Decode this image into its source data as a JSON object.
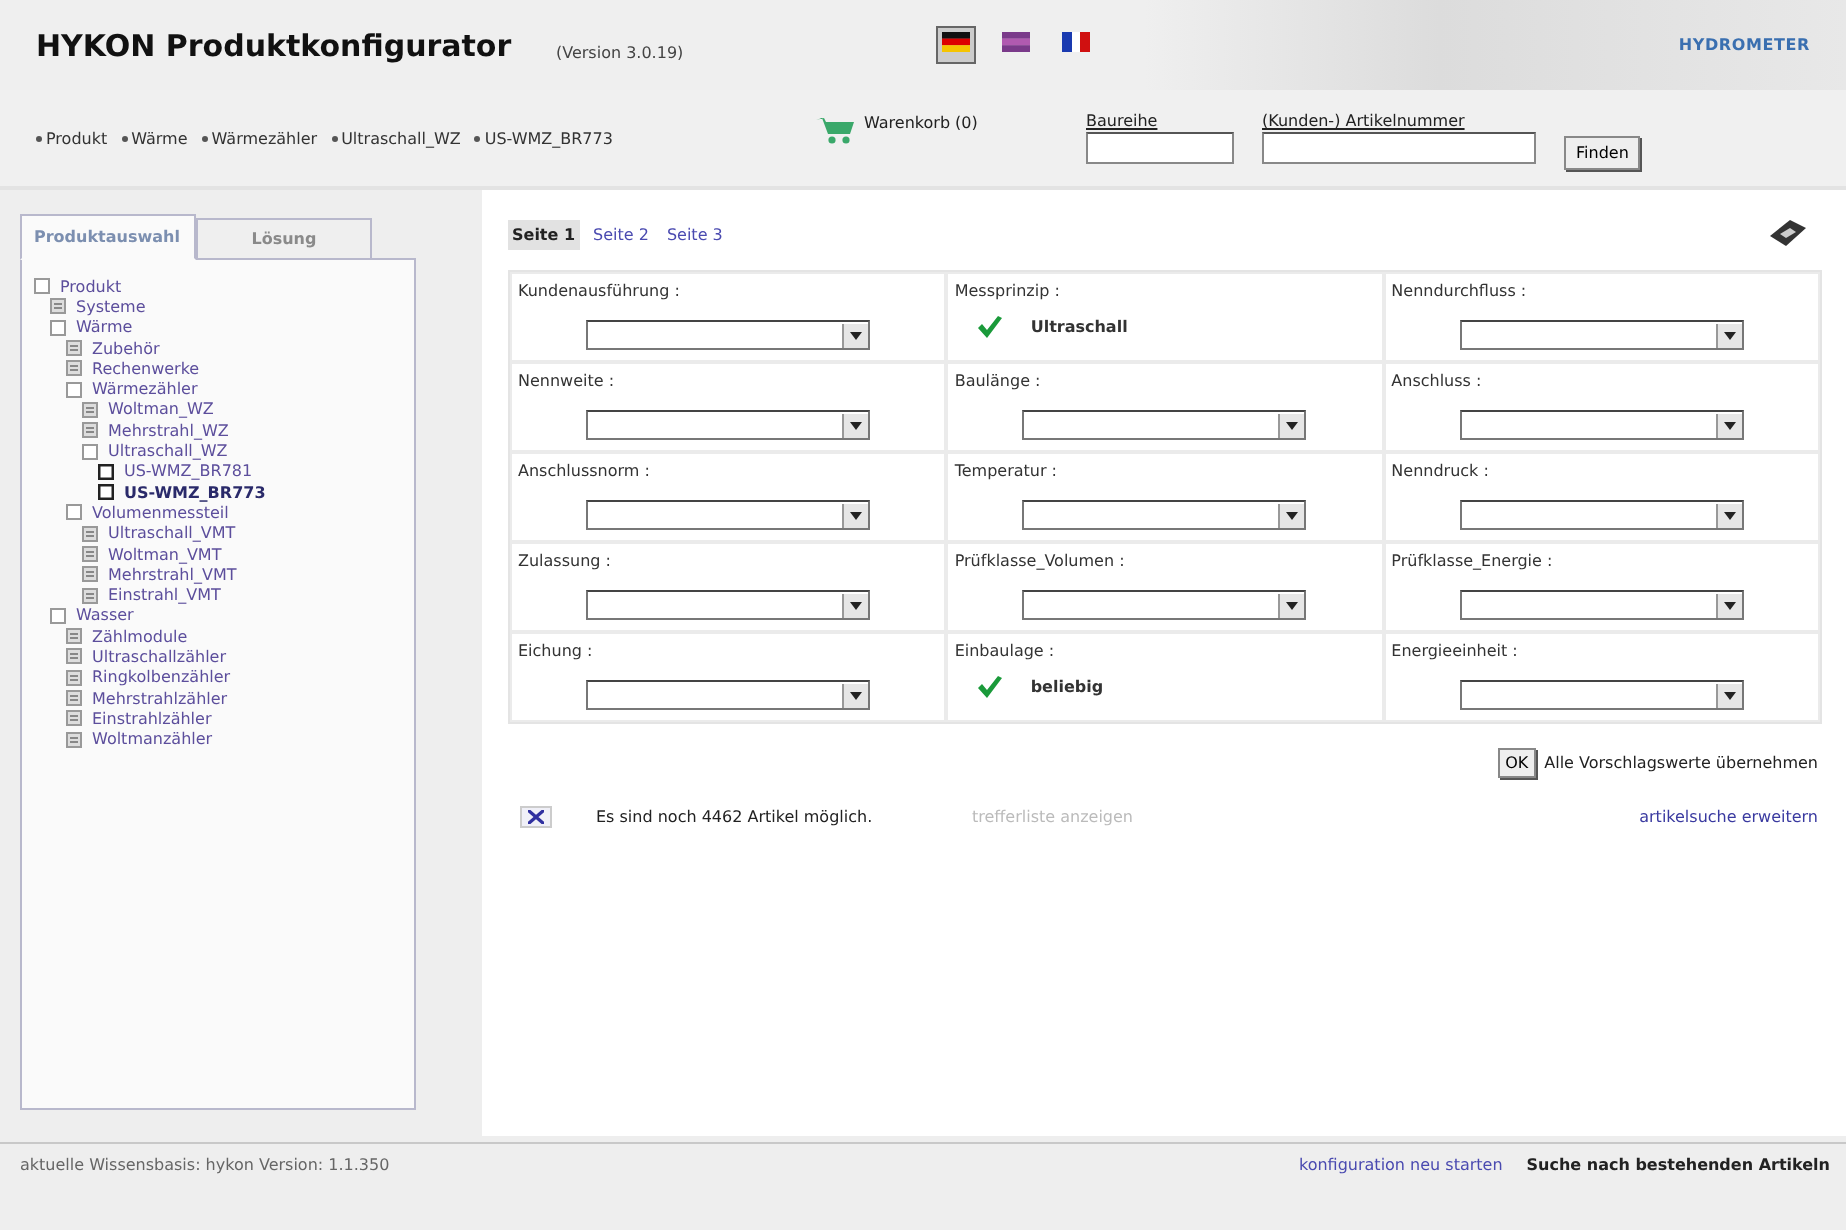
{
  "header": {
    "title": "HYKON Produktkonfigurator",
    "version": "(Version 3.0.19)",
    "languages": [
      {
        "kind": "de",
        "selected": true
      },
      {
        "kind": "en",
        "selected": false
      },
      {
        "kind": "fr",
        "selected": false
      }
    ],
    "logo": "HYDROMETER"
  },
  "breadcrumbs": [
    "Produkt",
    "Wärme",
    "Wärmezähler",
    "Ultraschall_WZ",
    "US-WMZ_BR773"
  ],
  "cart": {
    "label": "Warenkorb (0)"
  },
  "search": {
    "fields": [
      {
        "label": "Baureihe"
      },
      {
        "label": "(Kunden-) Artikelnummer"
      }
    ],
    "button": "Finden"
  },
  "sidebar": {
    "tabs": [
      {
        "label": "Produktauswahl",
        "selected": true,
        "disabled": false
      },
      {
        "label": "Lösung",
        "selected": false,
        "disabled": true
      }
    ],
    "tree": [
      {
        "label": "Produkt",
        "kind": "folder",
        "expanded": true,
        "children": [
          {
            "label": "Systeme",
            "kind": "folder",
            "expanded": false
          },
          {
            "label": "Wärme",
            "kind": "folder",
            "expanded": true,
            "children": [
              {
                "label": "Zubehör",
                "kind": "folder",
                "expanded": false
              },
              {
                "label": "Rechenwerke",
                "kind": "folder",
                "expanded": false
              },
              {
                "label": "Wärmezähler",
                "kind": "folder",
                "expanded": true,
                "children": [
                  {
                    "label": "Woltman_WZ",
                    "kind": "folder",
                    "expanded": false
                  },
                  {
                    "label": "Mehrstrahl_WZ",
                    "kind": "folder",
                    "expanded": false
                  },
                  {
                    "label": "Ultraschall_WZ",
                    "kind": "folder",
                    "expanded": true,
                    "children": [
                      {
                        "label": "US-WMZ_BR781",
                        "kind": "article",
                        "selected": false
                      },
                      {
                        "label": "US-WMZ_BR773",
                        "kind": "article",
                        "selected": true
                      }
                    ]
                  }
                ]
              },
              {
                "label": "Volumenmessteil",
                "kind": "folder",
                "expanded": true,
                "children": [
                  {
                    "label": "Ultraschall_VMT",
                    "kind": "folder",
                    "expanded": false
                  },
                  {
                    "label": "Woltman_VMT",
                    "kind": "folder",
                    "expanded": false
                  },
                  {
                    "label": "Mehrstrahl_VMT",
                    "kind": "folder",
                    "expanded": false
                  },
                  {
                    "label": "Einstrahl_VMT",
                    "kind": "folder",
                    "expanded": false
                  }
                ]
              }
            ]
          },
          {
            "label": "Wasser",
            "kind": "folder",
            "expanded": true,
            "children": [
              {
                "label": "Zählmodule",
                "kind": "folder",
                "expanded": false
              },
              {
                "label": "Ultraschallzähler",
                "kind": "folder",
                "expanded": false
              },
              {
                "label": "Ringkolbenzähler",
                "kind": "folder",
                "expanded": false
              },
              {
                "label": "Mehrstrahlzähler",
                "kind": "folder",
                "expanded": false
              },
              {
                "label": "Einstrahlzähler",
                "kind": "folder",
                "expanded": false
              },
              {
                "label": "Woltmanzähler",
                "kind": "folder",
                "expanded": false
              }
            ]
          }
        ]
      }
    ]
  },
  "pages": [
    {
      "label": "Seite 1",
      "selected": true
    },
    {
      "label": "Seite 2",
      "selected": false
    },
    {
      "label": "Seite 3",
      "selected": false
    }
  ],
  "fields": [
    {
      "label": "Kundenausführung :",
      "kind": "select"
    },
    {
      "label": "Messprinzip :",
      "kind": "value",
      "value": "Ultraschall"
    },
    {
      "label": "Nenndurchfluss :",
      "kind": "select"
    },
    {
      "label": "Nennweite :",
      "kind": "select"
    },
    {
      "label": "Baulänge :",
      "kind": "select"
    },
    {
      "label": "Anschluss :",
      "kind": "select"
    },
    {
      "label": "Anschlussnorm :",
      "kind": "select"
    },
    {
      "label": "Temperatur :",
      "kind": "select"
    },
    {
      "label": "Nenndruck :",
      "kind": "select"
    },
    {
      "label": "Zulassung :",
      "kind": "select"
    },
    {
      "label": "Prüfklasse_Volumen :",
      "kind": "select"
    },
    {
      "label": "Prüfklasse_Energie :",
      "kind": "select"
    },
    {
      "label": "Eichung :",
      "kind": "select"
    },
    {
      "label": "Einbaulage :",
      "kind": "value",
      "value": "beliebig"
    },
    {
      "label": "Energieeinheit :",
      "kind": "select"
    }
  ],
  "accept": {
    "button": "OK",
    "label": "Alle Vorschlagswerte übernehmen"
  },
  "results": {
    "message": "Es sind noch 4462 Artikel möglich.",
    "show_list": {
      "label": "trefferliste anzeigen",
      "disabled": true
    },
    "extend": "artikelsuche erweitern"
  },
  "status_bar": {
    "knowledge_base": "aktuelle Wissensbasis: hykon Version: 1.1.350",
    "restart": "konfiguration neu starten",
    "search_existing": "Suche nach bestehenden Artikeln"
  }
}
